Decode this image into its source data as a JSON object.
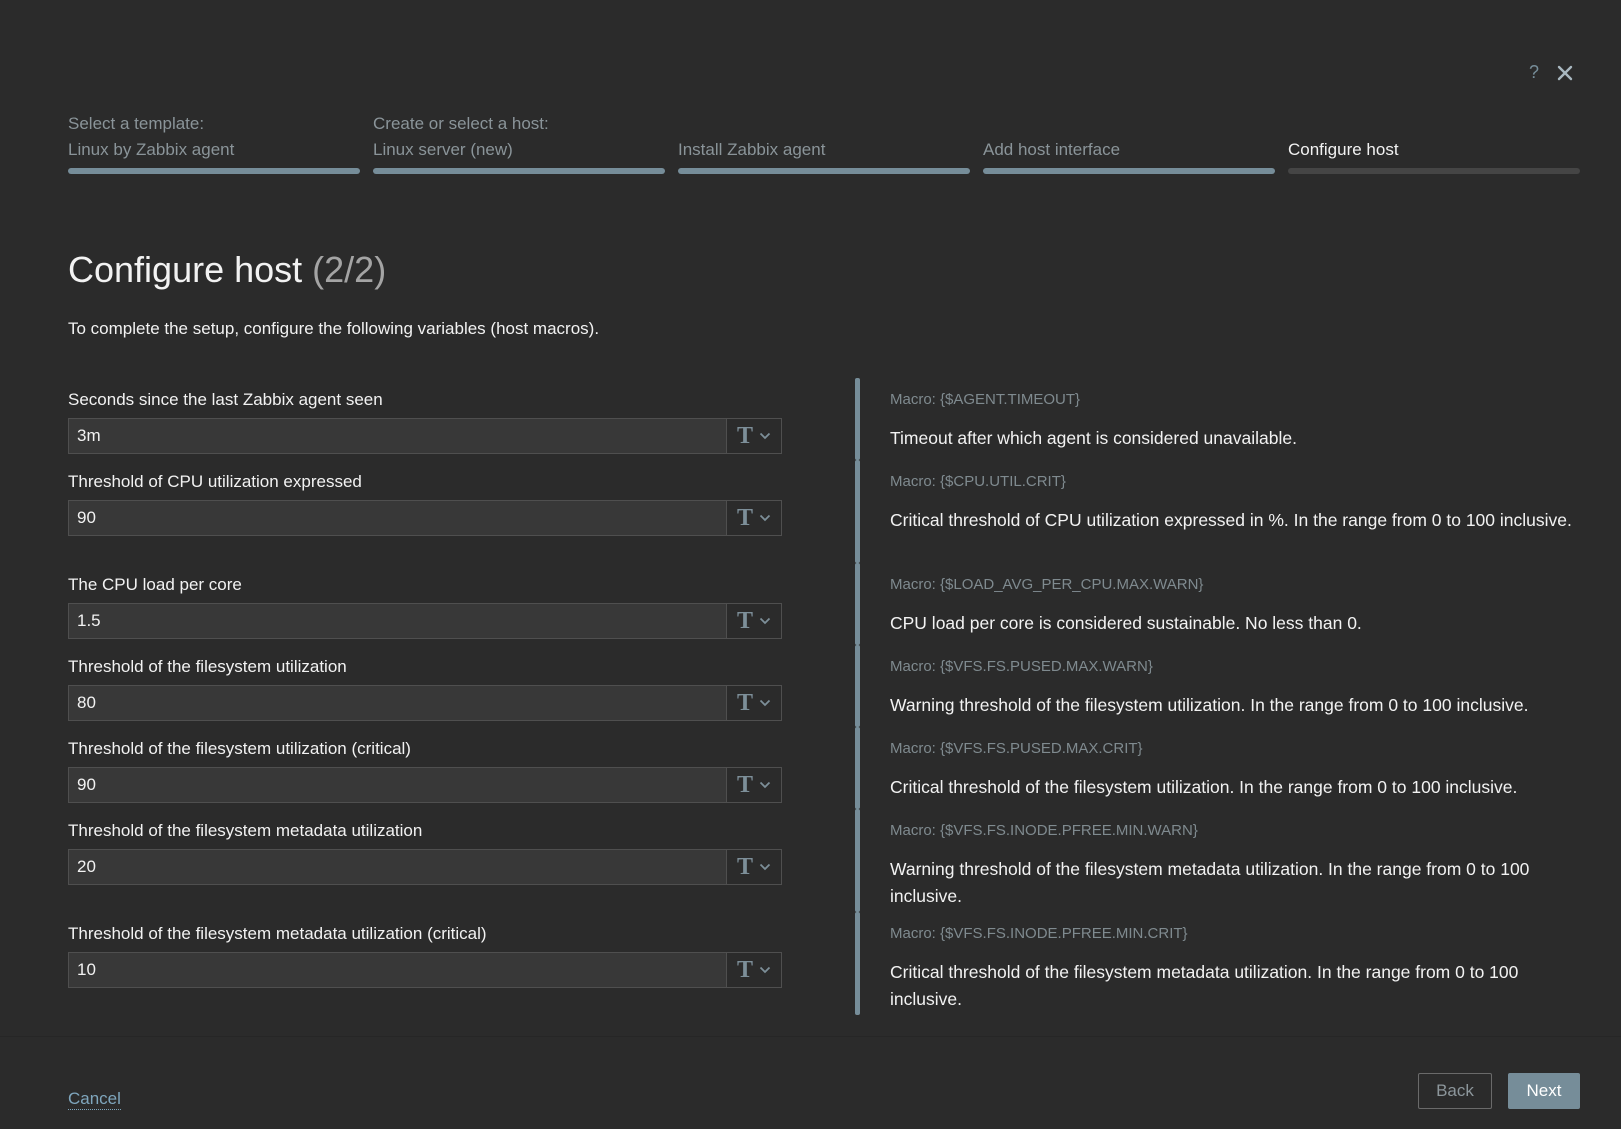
{
  "dialog": {
    "help_label": "?"
  },
  "steps": [
    {
      "line1": "Select a template:",
      "line2": "Linux by Zabbix agent",
      "state": "done"
    },
    {
      "line1": "Create or select a host:",
      "line2": "Linux server (new)",
      "state": "done"
    },
    {
      "line1": "",
      "line2": "Install Zabbix agent",
      "state": "done"
    },
    {
      "line1": "",
      "line2": "Add host interface",
      "state": "done"
    },
    {
      "line1": "",
      "line2": "Configure host",
      "state": "current"
    }
  ],
  "header": {
    "title": "Configure host",
    "subtitle": "(2/2)",
    "description": "To complete the setup, configure the following variables (host macros)."
  },
  "macros": [
    {
      "label": "Seconds since the last Zabbix agent seen",
      "value": "3m",
      "macro": "Macro: {$AGENT.TIMEOUT}",
      "description": "Timeout after which agent is considered unavailable.",
      "value_type_icon": "text-type-icon"
    },
    {
      "label": "Threshold of CPU utilization expressed",
      "value": "90",
      "macro": "Macro: {$CPU.UTIL.CRIT}",
      "description": "Critical threshold of CPU utilization expressed in %. In the range from 0 to 100 inclusive.",
      "value_type_icon": "text-type-icon"
    },
    {
      "label": "The CPU load per core",
      "value": "1.5",
      "macro": "Macro: {$LOAD_AVG_PER_CPU.MAX.WARN}",
      "description": "CPU load per core is considered sustainable. No less than 0.",
      "value_type_icon": "text-type-icon"
    },
    {
      "label": "Threshold of the filesystem utilization",
      "value": "80",
      "macro": "Macro: {$VFS.FS.PUSED.MAX.WARN}",
      "description": "Warning threshold of the filesystem utilization. In the range from 0 to 100 inclusive.",
      "value_type_icon": "text-type-icon"
    },
    {
      "label": "Threshold of the filesystem utilization (critical)",
      "value": "90",
      "macro": "Macro: {$VFS.FS.PUSED.MAX.CRIT}",
      "description": "Critical threshold of the filesystem utilization. In the range from 0 to 100 inclusive.",
      "value_type_icon": "text-type-icon"
    },
    {
      "label": "Threshold of the filesystem metadata utilization",
      "value": "20",
      "macro": "Macro: {$VFS.FS.INODE.PFREE.MIN.WARN}",
      "description": "Warning threshold of the filesystem metadata utilization. In the range from 0 to 100 inclusive.",
      "value_type_icon": "text-type-icon"
    },
    {
      "label": "Threshold of the filesystem metadata utilization (critical)",
      "value": "10",
      "macro": "Macro: {$VFS.FS.INODE.PFREE.MIN.CRIT}",
      "description": "Critical threshold of the filesystem metadata utilization. In the range from 0 to 100 inclusive.",
      "value_type_icon": "text-type-icon"
    }
  ],
  "footer": {
    "cancel_label": "Cancel",
    "back_label": "Back",
    "next_label": "Next"
  },
  "colors": {
    "background": "#2b2b2b",
    "accent": "#768d99",
    "link": "#7fa6bd",
    "muted_text": "#7f8a8f",
    "input_bg": "#383838"
  }
}
